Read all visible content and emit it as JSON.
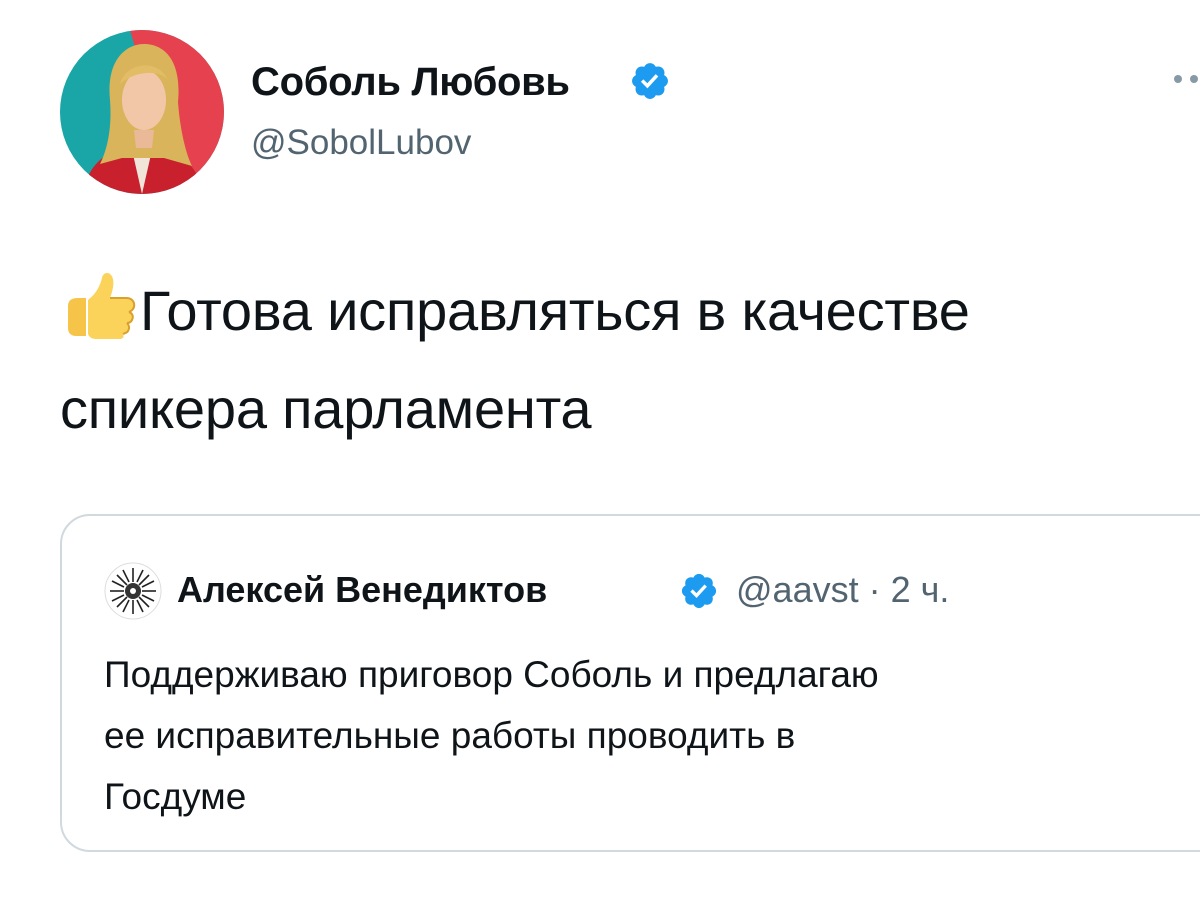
{
  "author": {
    "name": "Соболь Любовь",
    "handle": "@SobolLubov",
    "verified": true
  },
  "tweet": {
    "emoji": "thumbs-up-emoji",
    "text_line1": "Готова исправляться в качестве",
    "text_line2": "спикера парламента"
  },
  "quoted": {
    "name": "Алексей Венедиктов",
    "verified": true,
    "handle": "@aavst",
    "separator": "·",
    "time": "2 ч.",
    "text_line1": "Поддерживаю приговор Соболь и предлагаю",
    "text_line2": "ее исправительные работы проводить в",
    "text_line3": "Госдуме"
  },
  "colors": {
    "verified_blue": "#1d9bf0",
    "secondary_text": "#536471",
    "border": "#cfd9de",
    "avatar_teal": "#1aa6a6",
    "avatar_red": "#e6414f"
  }
}
